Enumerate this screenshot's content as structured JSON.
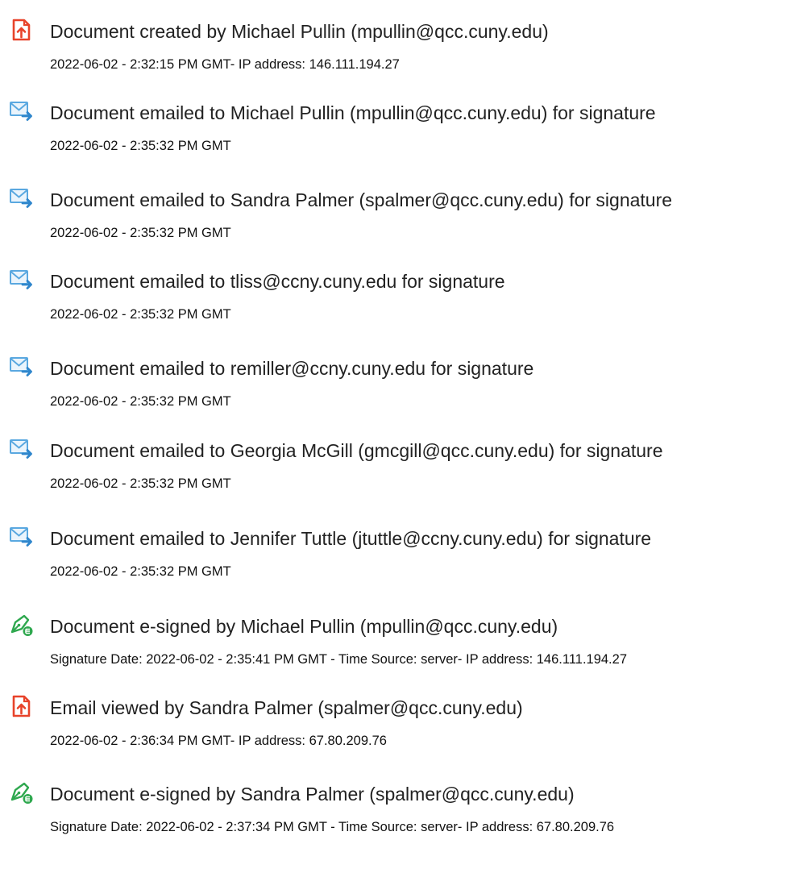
{
  "audit": {
    "entries": [
      {
        "icon": "document-created-icon",
        "title": "Document created by Michael Pullin (mpullin@qcc.cuny.edu)",
        "detail": "2022-06-02 - 2:32:15 PM GMT- IP address: 146.111.194.27"
      },
      {
        "icon": "email-sent-icon",
        "title": "Document emailed to Michael Pullin (mpullin@qcc.cuny.edu) for signature",
        "detail": "2022-06-02 - 2:35:32 PM GMT"
      },
      {
        "icon": "email-sent-icon",
        "title": "Document emailed to Sandra Palmer (spalmer@qcc.cuny.edu) for signature",
        "detail": "2022-06-02 - 2:35:32 PM GMT"
      },
      {
        "icon": "email-sent-icon",
        "title": "Document emailed to tliss@ccny.cuny.edu for signature",
        "detail": "2022-06-02 - 2:35:32 PM GMT"
      },
      {
        "icon": "email-sent-icon",
        "title": "Document emailed to remiller@ccny.cuny.edu for signature",
        "detail": "2022-06-02 - 2:35:32 PM GMT"
      },
      {
        "icon": "email-sent-icon",
        "title": "Document emailed to Georgia McGill (gmcgill@qcc.cuny.edu) for signature",
        "detail": "2022-06-02 - 2:35:32 PM GMT"
      },
      {
        "icon": "email-sent-icon",
        "title": "Document emailed to Jennifer Tuttle (jtuttle@ccny.cuny.edu) for signature",
        "detail": "2022-06-02 - 2:35:32 PM GMT"
      },
      {
        "icon": "e-signature-icon",
        "title": "Document e-signed by Michael Pullin (mpullin@qcc.cuny.edu)",
        "detail": "Signature Date: 2022-06-02 - 2:35:41 PM GMT - Time Source: server- IP address: 146.111.194.27"
      },
      {
        "icon": "document-viewed-icon",
        "title": "Email viewed by Sandra Palmer (spalmer@qcc.cuny.edu)",
        "detail": "2022-06-02 - 2:36:34 PM GMT- IP address: 67.80.209.76"
      },
      {
        "icon": "e-signature-icon",
        "title": "Document e-signed by Sandra Palmer (spalmer@qcc.cuny.edu)",
        "detail": "Signature Date: 2022-06-02 - 2:37:34 PM GMT - Time Source: server- IP address: 67.80.209.76"
      }
    ]
  },
  "colors": {
    "document_icon": "#e8432a",
    "email_icon": "#5aa8e0",
    "email_arrow": "#2f86cc",
    "signature_pen": "#2fa84f",
    "signature_badge": "#2fa84f",
    "text": "#222222"
  }
}
